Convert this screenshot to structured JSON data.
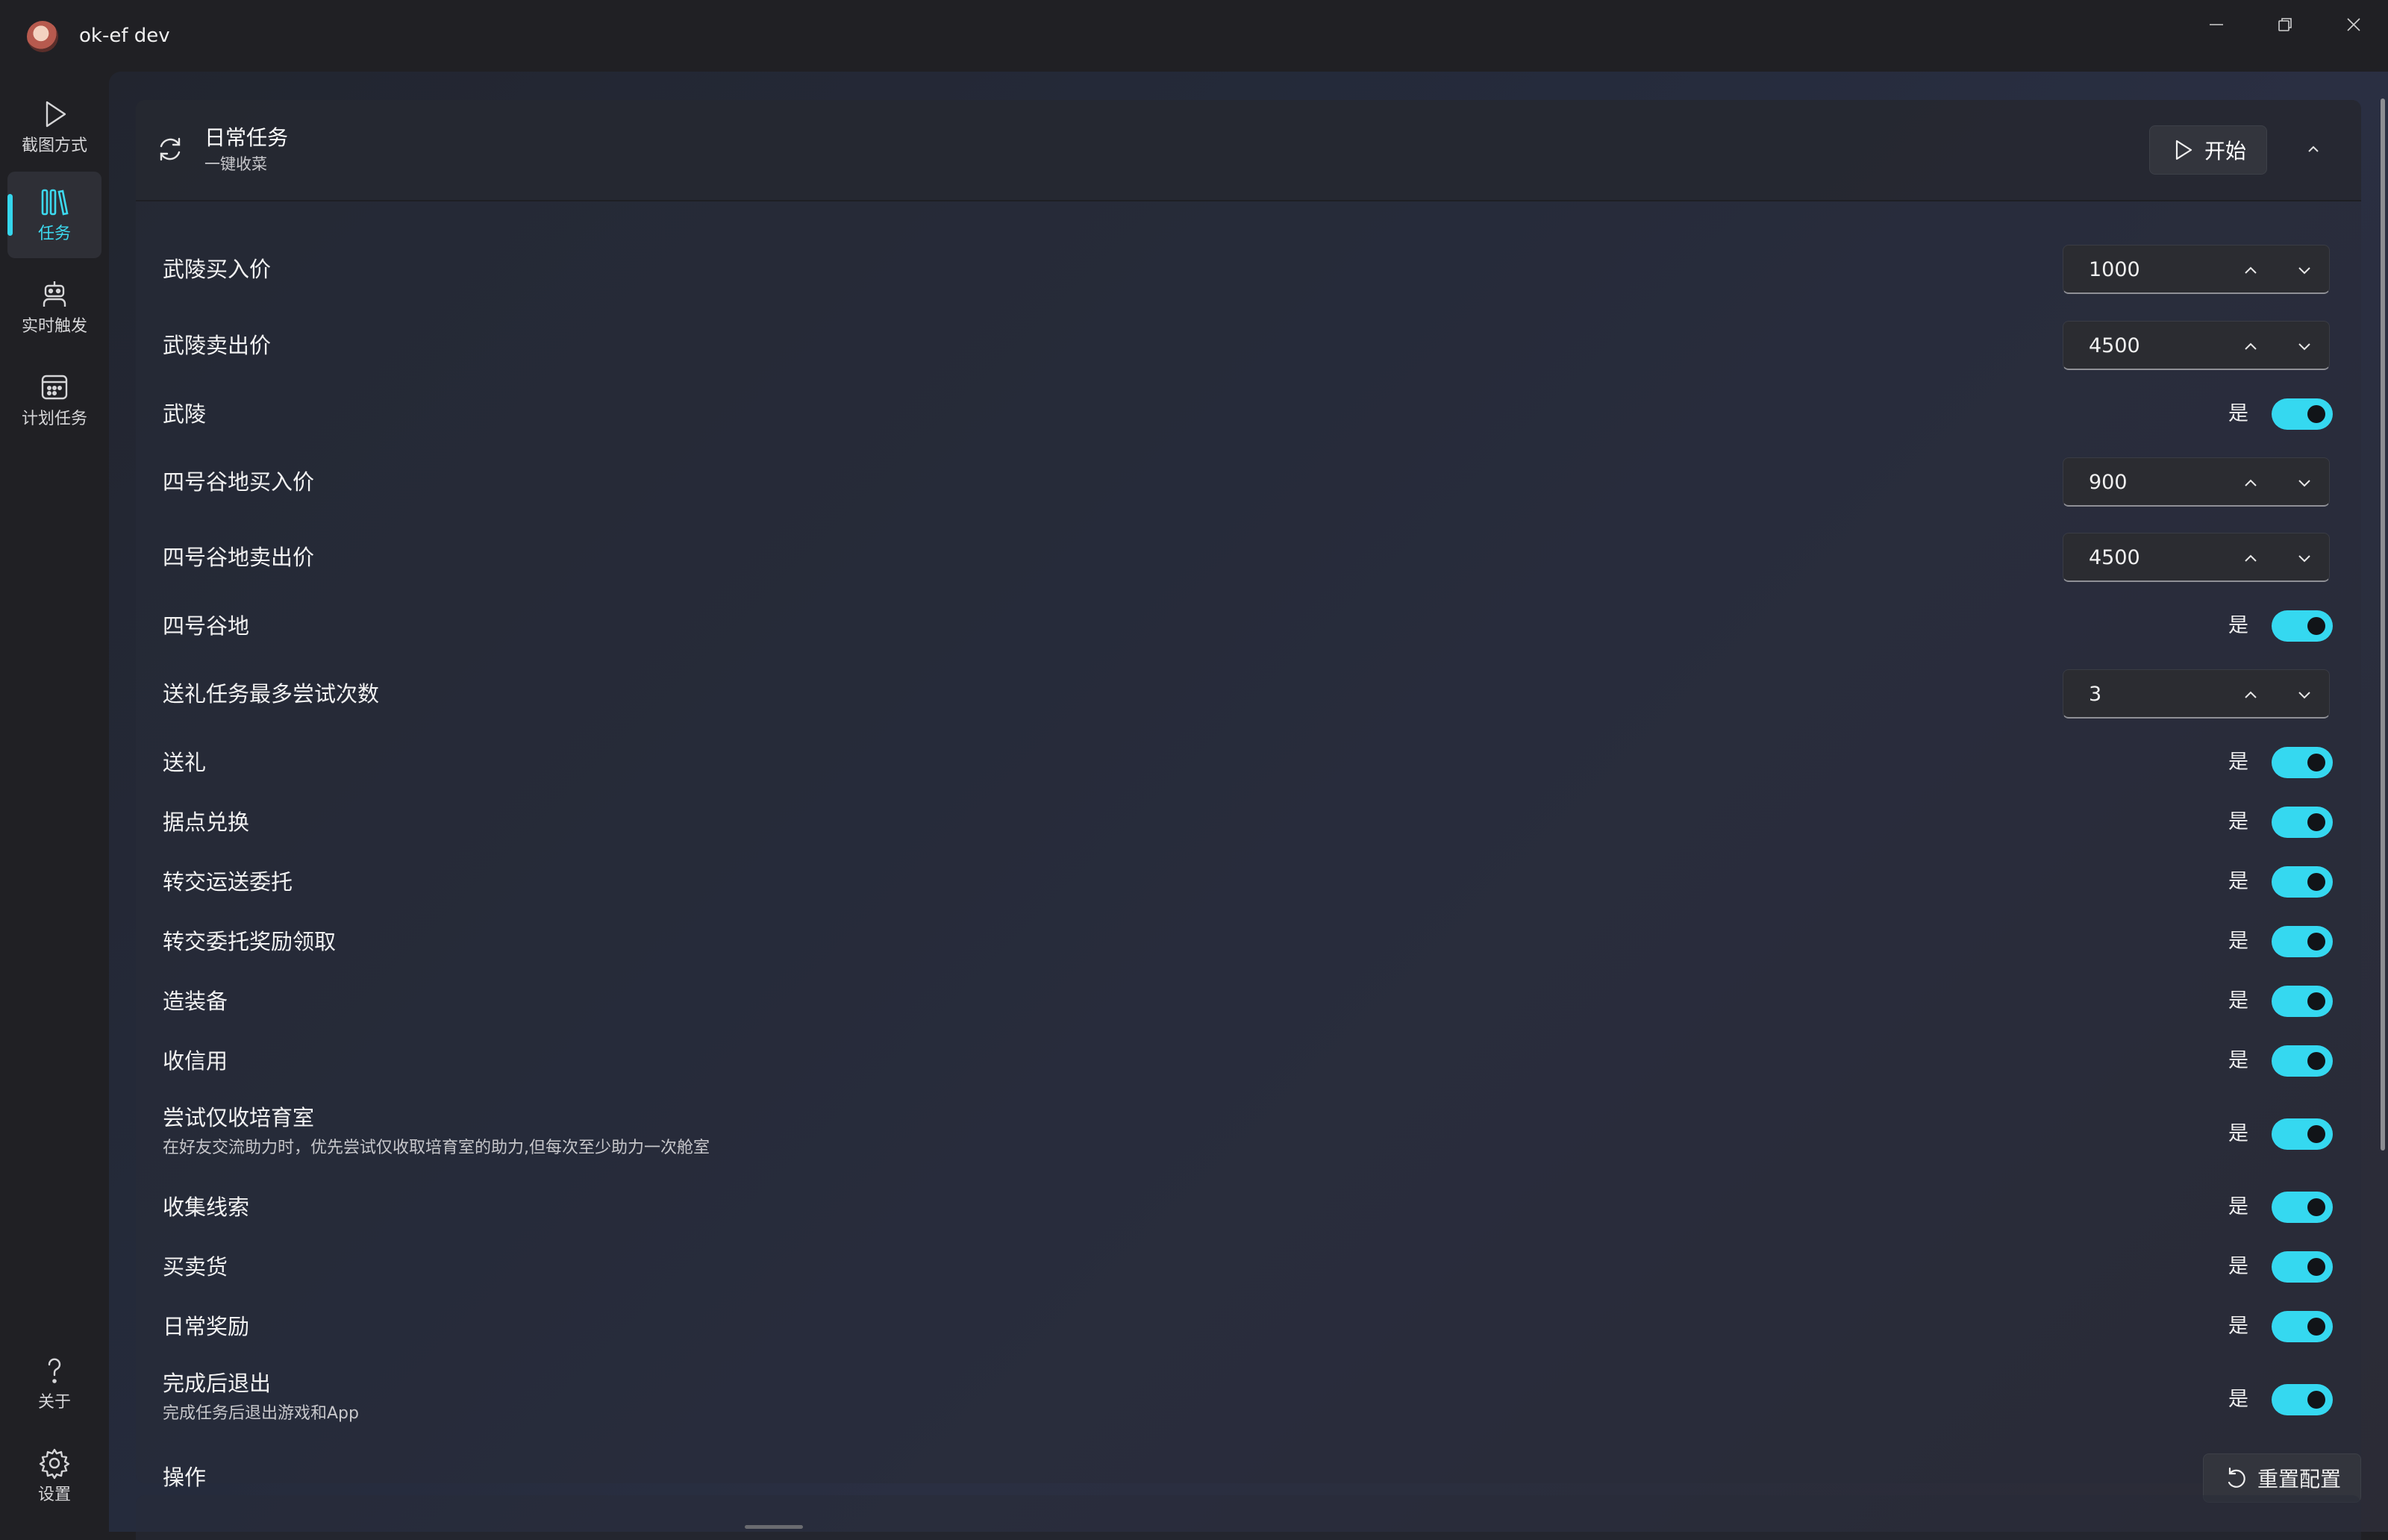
{
  "window": {
    "title": "ok-ef dev"
  },
  "nav": {
    "items": [
      {
        "label": "截图方式",
        "icon": "play-icon",
        "active": false
      },
      {
        "label": "任务",
        "icon": "library-icon",
        "active": true
      },
      {
        "label": "实时触发",
        "icon": "robot-icon",
        "active": false
      },
      {
        "label": "计划任务",
        "icon": "calendar-icon",
        "active": false
      }
    ],
    "bottom": [
      {
        "label": "关于",
        "icon": "question-icon"
      },
      {
        "label": "设置",
        "icon": "gear-icon"
      }
    ]
  },
  "task": {
    "title": "日常任务",
    "subtitle": "一键收菜",
    "start_label": "开始",
    "rows": [
      {
        "type": "spin",
        "label": "武陵买入价",
        "value": "1000"
      },
      {
        "type": "spin",
        "label": "武陵卖出价",
        "value": "4500"
      },
      {
        "type": "toggle",
        "label": "武陵",
        "state": "是",
        "on": true
      },
      {
        "type": "spin",
        "label": "四号谷地买入价",
        "value": "900"
      },
      {
        "type": "spin",
        "label": "四号谷地卖出价",
        "value": "4500"
      },
      {
        "type": "toggle",
        "label": "四号谷地",
        "state": "是",
        "on": true
      },
      {
        "type": "spin",
        "label": "送礼任务最多尝试次数",
        "value": "3"
      },
      {
        "type": "toggle",
        "label": "送礼",
        "state": "是",
        "on": true
      },
      {
        "type": "toggle",
        "label": "据点兑换",
        "state": "是",
        "on": true
      },
      {
        "type": "toggle",
        "label": "转交运送委托",
        "state": "是",
        "on": true
      },
      {
        "type": "toggle",
        "label": "转交委托奖励领取",
        "state": "是",
        "on": true
      },
      {
        "type": "toggle",
        "label": "造装备",
        "state": "是",
        "on": true
      },
      {
        "type": "toggle",
        "label": "收信用",
        "state": "是",
        "on": true
      },
      {
        "type": "toggle",
        "label": "尝试仅收培育室",
        "description": "在好友交流助力时，优先尝试仅收取培育室的助力,但每次至少助力一次舱室",
        "state": "是",
        "on": true
      },
      {
        "type": "toggle",
        "label": "收集线索",
        "state": "是",
        "on": true
      },
      {
        "type": "toggle",
        "label": "买卖货",
        "state": "是",
        "on": true
      },
      {
        "type": "toggle",
        "label": "日常奖励",
        "state": "是",
        "on": true
      },
      {
        "type": "toggle",
        "label": "完成后退出",
        "description": "完成任务后退出游戏和App",
        "state": "是",
        "on": true
      }
    ],
    "actions_label": "操作",
    "reset_label": "重置配置"
  },
  "colors": {
    "accent": "#35d8f0",
    "background": "#202024"
  }
}
